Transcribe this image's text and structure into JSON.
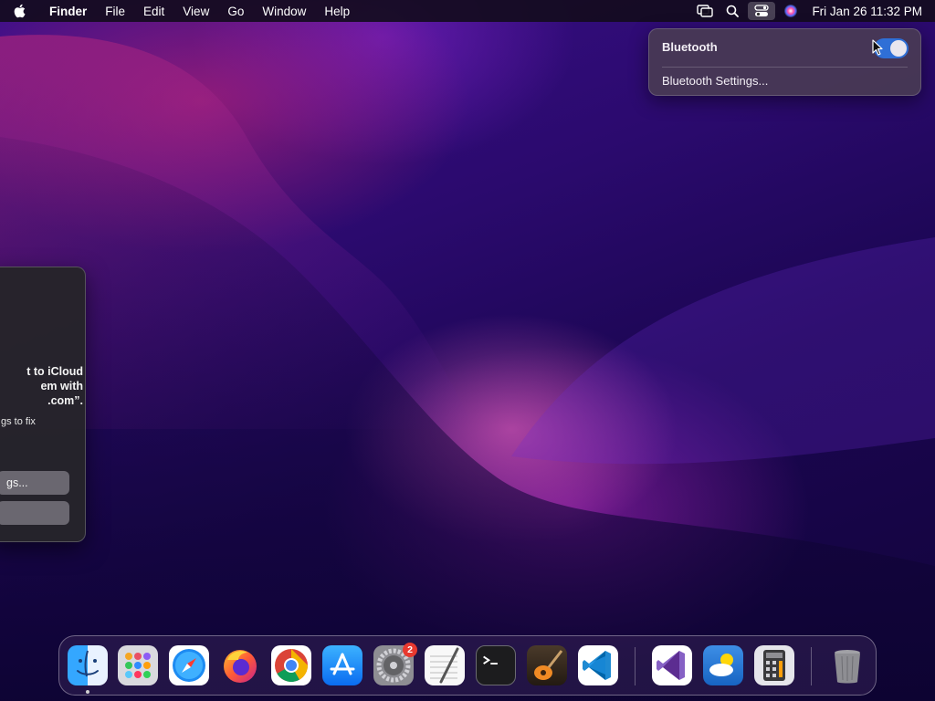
{
  "menubar": {
    "app_name": "Finder",
    "menus": [
      "File",
      "Edit",
      "View",
      "Go",
      "Window",
      "Help"
    ],
    "status_icons": [
      "screen-mirroring-icon",
      "spotlight-search-icon",
      "control-center-icon",
      "siri-icon"
    ],
    "clock": "Fri Jan 26  11:32 PM"
  },
  "bluetooth_panel": {
    "title": "Bluetooth",
    "toggle_on": true,
    "settings_link": "Bluetooth Settings..."
  },
  "notification_dialog": {
    "title_partial": "t to iCloud\nem with\n.com”.",
    "body_partial": "gs to fix",
    "button_1_partial": "gs...",
    "button_2_partial": ""
  },
  "dock": {
    "apps": [
      {
        "name": "Finder",
        "icon": "finder-icon",
        "running": true
      },
      {
        "name": "Launchpad",
        "icon": "launchpad-icon"
      },
      {
        "name": "Safari",
        "icon": "safari-icon"
      },
      {
        "name": "Firefox",
        "icon": "firefox-icon"
      },
      {
        "name": "Google Chrome",
        "icon": "chrome-icon"
      },
      {
        "name": "App Store",
        "icon": "app-store-icon"
      },
      {
        "name": "System Settings",
        "icon": "system-settings-icon",
        "badge": "2"
      },
      {
        "name": "TextEdit",
        "icon": "textedit-icon"
      },
      {
        "name": "Terminal",
        "icon": "terminal-icon"
      },
      {
        "name": "GarageBand",
        "icon": "garageband-icon"
      },
      {
        "name": "Visual Studio Code",
        "icon": "vscode-icon"
      },
      {
        "name": "Visual Studio",
        "icon": "visual-studio-icon"
      },
      {
        "name": "Weather",
        "icon": "weather-icon"
      },
      {
        "name": "Calculator",
        "icon": "calculator-icon"
      },
      {
        "name": "Trash",
        "icon": "trash-icon"
      }
    ]
  }
}
